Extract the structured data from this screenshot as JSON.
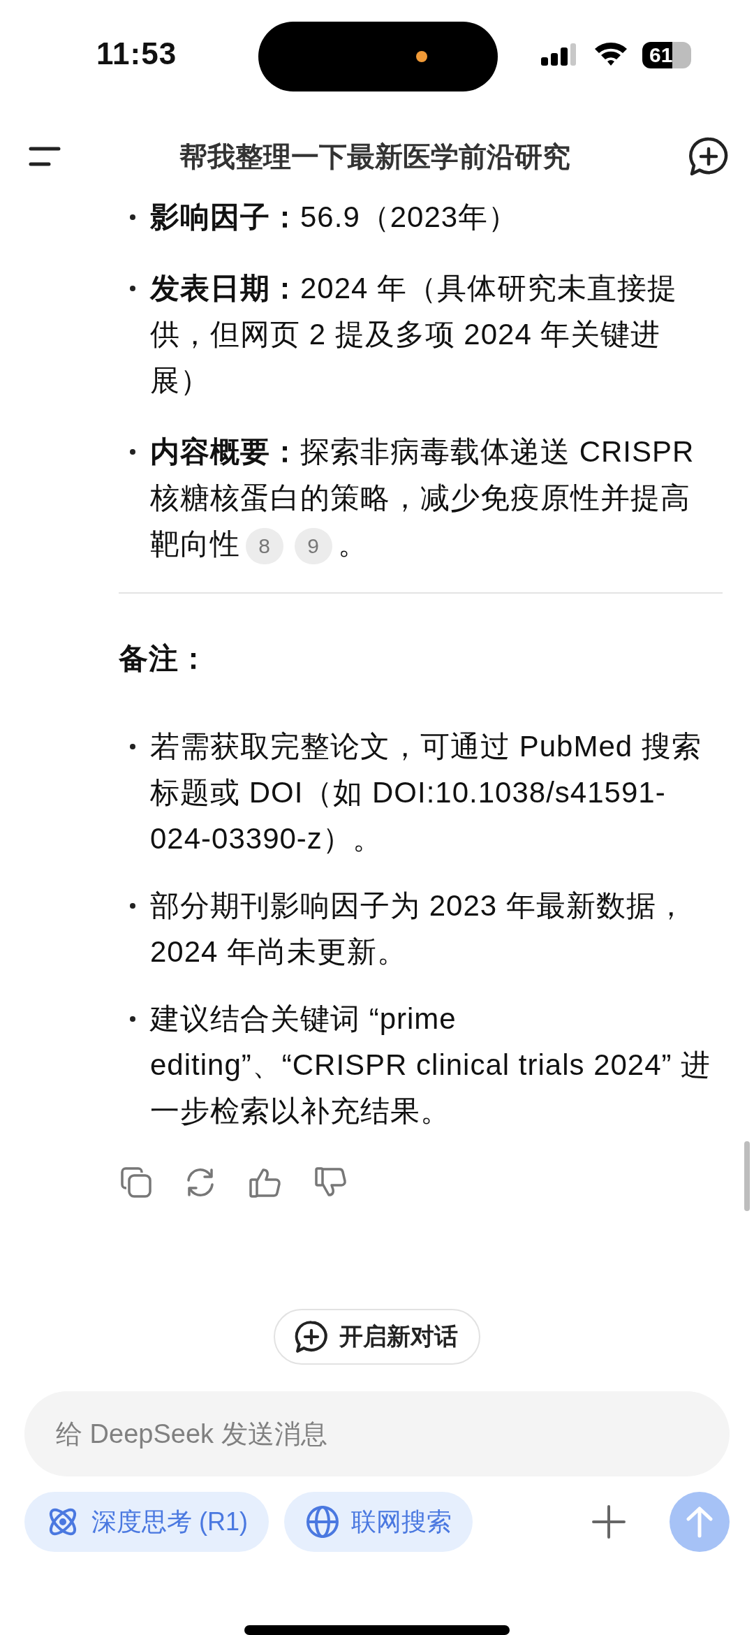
{
  "status_bar": {
    "time": "11:53",
    "battery": "61"
  },
  "header": {
    "title": "帮我整理一下最新医学前沿研究"
  },
  "details": [
    {
      "label": "影响因子：",
      "text": "56.9（2023年）"
    },
    {
      "label": "发表日期：",
      "text": "2024 年（具体研究未直接提供，但网页 2 提及多项 2024 年关键进展）"
    },
    {
      "label": "内容概要：",
      "text": "探索非病毒载体递送 CRISPR 核糖核蛋白的策略，减少免疫原性并提高靶向性",
      "citations": [
        "8",
        "9"
      ],
      "after": "。"
    }
  ],
  "notes": {
    "heading": "备注：",
    "items": [
      "若需获取完整论文，可通过 PubMed 搜索标题或 DOI（如 DOI:10.1038/s41591-024-03390-z）。",
      "部分期刊影响因子为 2023 年最新数据，2024 年尚未更新。",
      "建议结合关键词 “prime editing”、“CRISPR clinical trials 2024” 进一步检索以补充结果。"
    ]
  },
  "new_chat_button": "开启新对话",
  "composer": {
    "placeholder": "给 DeepSeek 发送消息",
    "send_disabled": true,
    "toggles": [
      {
        "kind": "deep-think",
        "label": "深度思考 (R1)",
        "selected": true
      },
      {
        "kind": "web-search",
        "label": "联网搜索",
        "selected": true
      }
    ]
  }
}
